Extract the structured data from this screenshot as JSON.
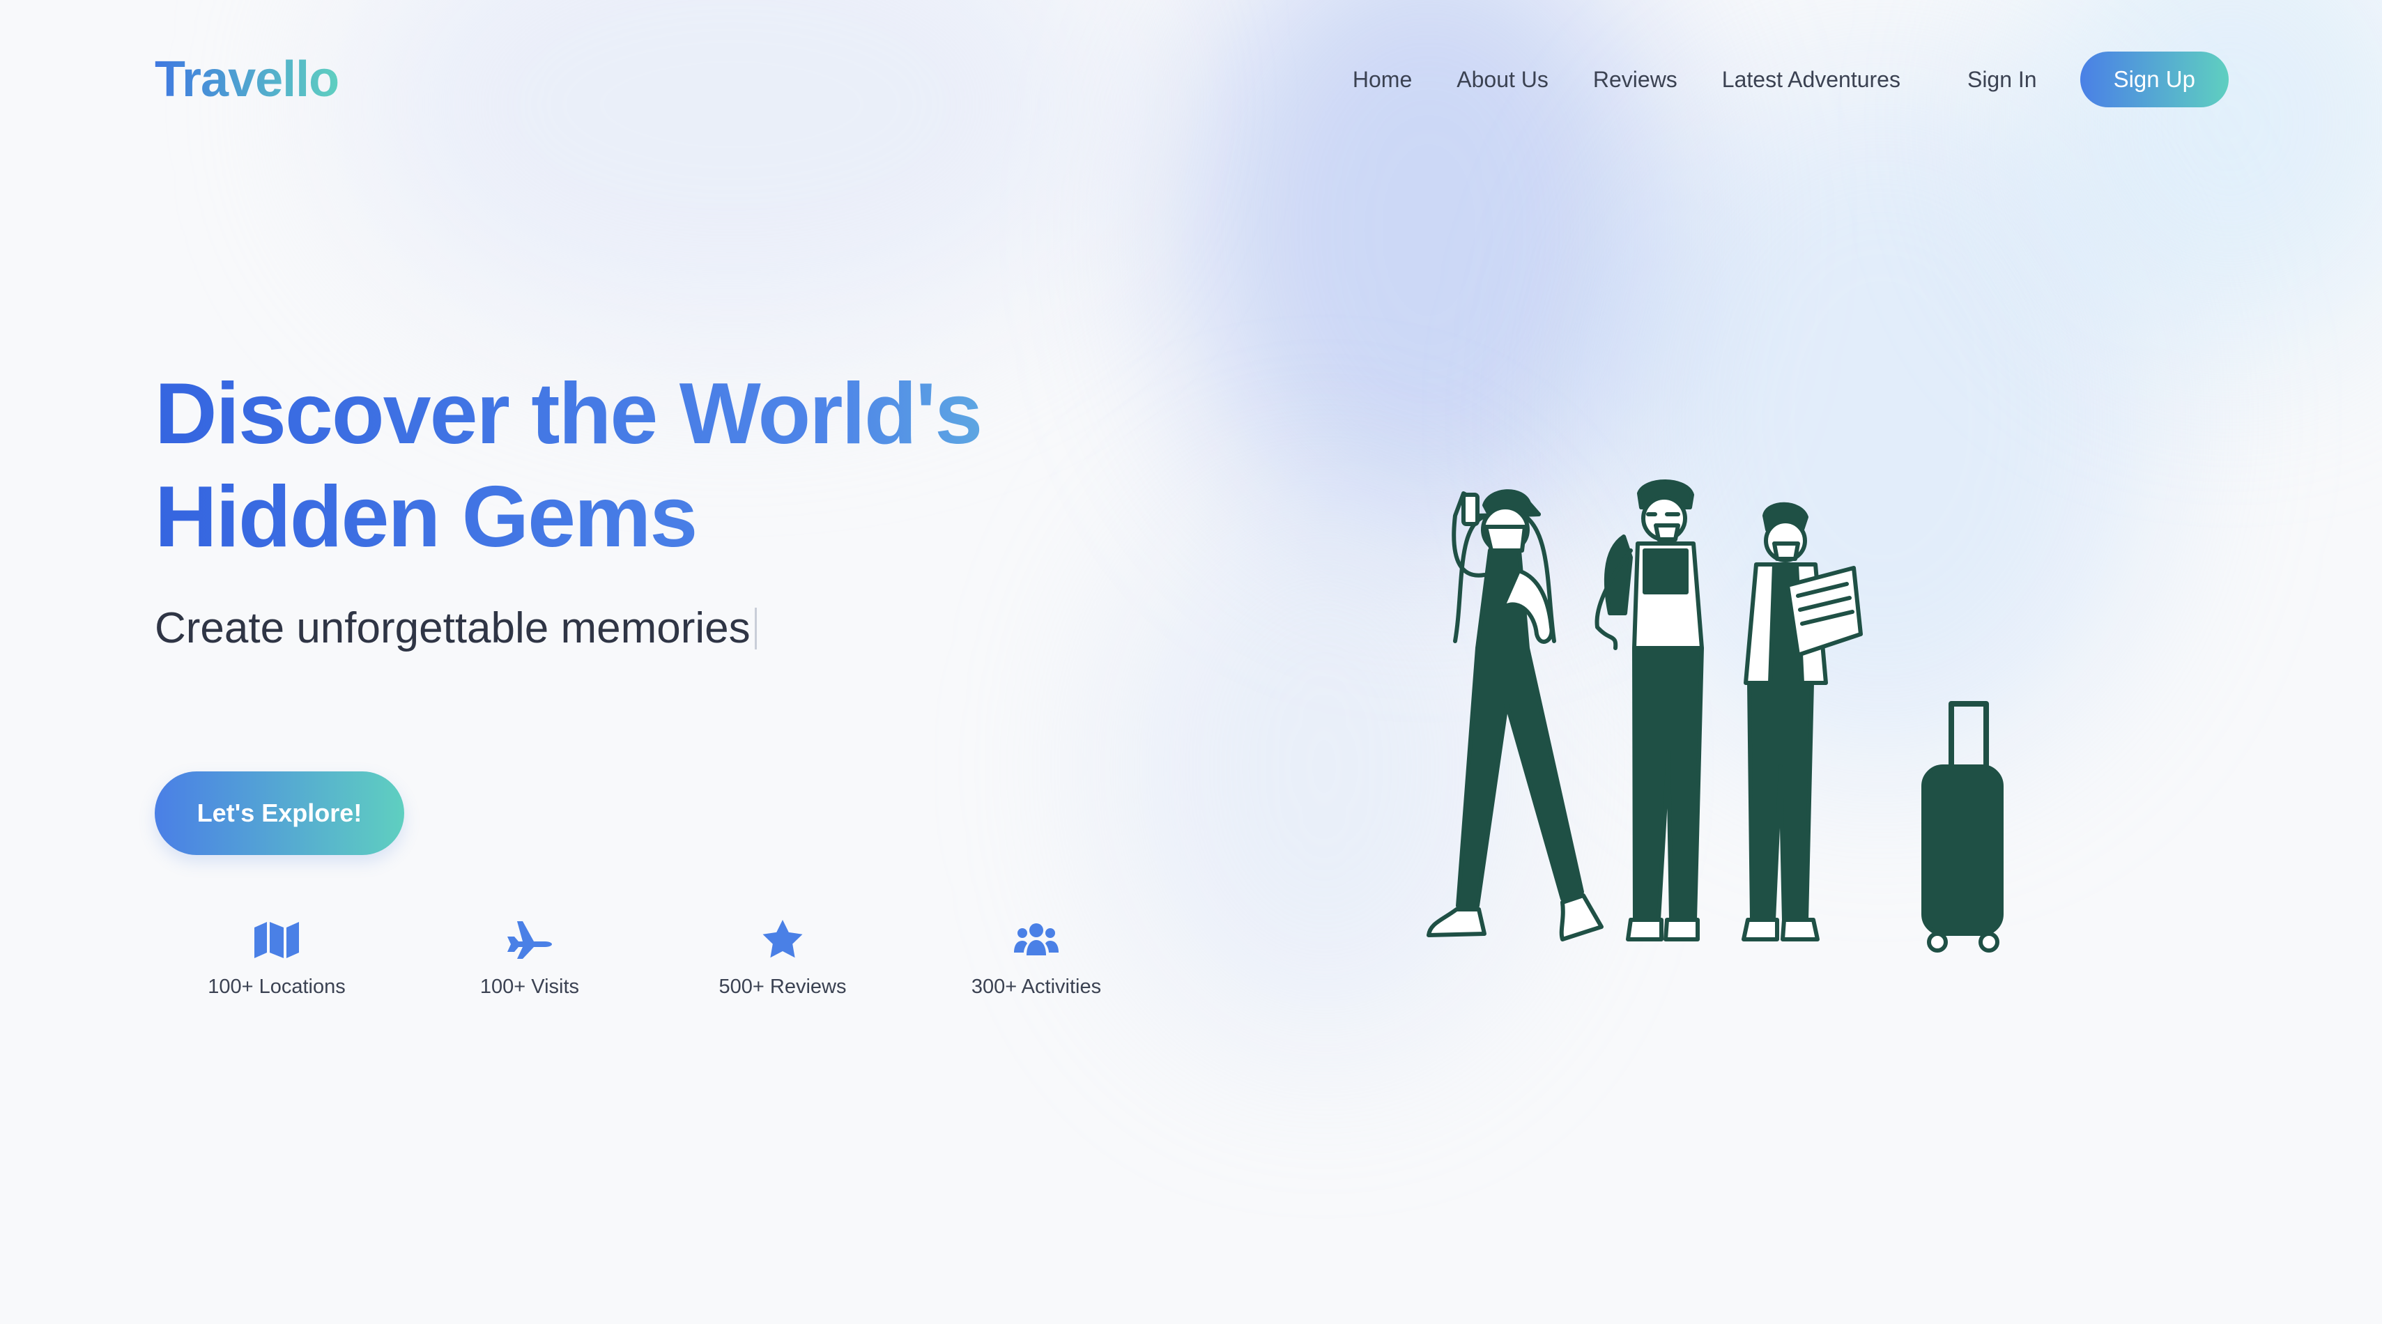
{
  "header": {
    "logo": "Travello",
    "nav": [
      "Home",
      "About Us",
      "Reviews",
      "Latest Adventures"
    ],
    "sign_in": "Sign In",
    "sign_up": "Sign Up"
  },
  "hero": {
    "title_line1": "Discover the World's",
    "title_line2": "Hidden Gems",
    "subtitle": "Create unforgettable memories",
    "cta": "Let's Explore!"
  },
  "stats": [
    {
      "icon": "map-icon",
      "label": "100+ Locations"
    },
    {
      "icon": "plane-icon",
      "label": "100+ Visits"
    },
    {
      "icon": "star-icon",
      "label": "500+ Reviews"
    },
    {
      "icon": "users-icon",
      "label": "300+ Activities"
    }
  ],
  "colors": {
    "accent_blue": "#3f78e0",
    "accent_teal": "#5fcfc0",
    "illustration_green": "#1f5045",
    "icon_blue": "#4a80e6"
  }
}
